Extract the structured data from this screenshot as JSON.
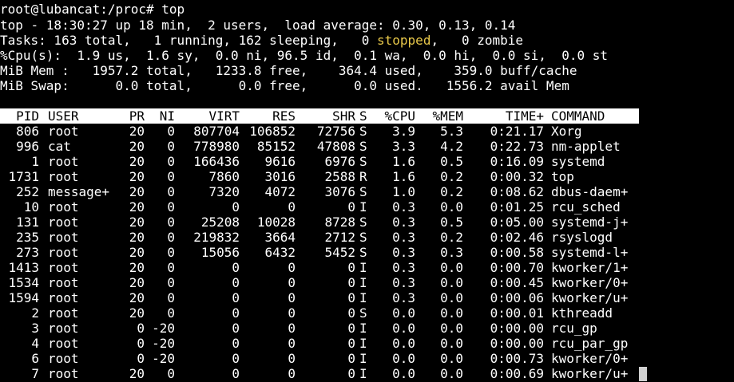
{
  "prompt": "root@lubancat:/proc# top",
  "summary": {
    "uptime_line": "top - 18:30:27 up 18 min,  2 users,  load average: 0.30, 0.13, 0.14",
    "tasks_prefix": "Tasks: 163 total,   1 running, 162 sleeping,   0 ",
    "tasks_stopped_label": "stopped",
    "tasks_suffix": ",   0 zombie",
    "cpu_line": "%Cpu(s):  1.9 us,  1.6 sy,  0.0 ni, 96.5 id,  0.1 wa,  0.0 hi,  0.0 si,  0.0 st",
    "mem_line": "MiB Mem :   1957.2 total,   1233.8 free,    364.4 used,    359.0 buff/cache",
    "swap_line": "MiB Swap:      0.0 total,      0.0 free,      0.0 used.   1556.2 avail Mem"
  },
  "table": {
    "headers": {
      "pid": "PID",
      "user": "USER",
      "pr": "PR",
      "ni": "NI",
      "virt": "VIRT",
      "res": "RES",
      "shr": "SHR",
      "s": "S",
      "cpu": "%CPU",
      "mem": "%MEM",
      "time": "TIME+",
      "command": "COMMAND"
    },
    "rows": [
      {
        "pid": "806",
        "user": "root",
        "pr": "20",
        "ni": "0",
        "virt": "807704",
        "res": "106852",
        "shr": "72756",
        "s": "S",
        "cpu": "3.9",
        "mem": "5.3",
        "time": "0:21.17",
        "command": "Xorg"
      },
      {
        "pid": "996",
        "user": "cat",
        "pr": "20",
        "ni": "0",
        "virt": "778980",
        "res": "85152",
        "shr": "47808",
        "s": "S",
        "cpu": "3.3",
        "mem": "4.2",
        "time": "0:22.73",
        "command": "nm-applet"
      },
      {
        "pid": "1",
        "user": "root",
        "pr": "20",
        "ni": "0",
        "virt": "166436",
        "res": "9616",
        "shr": "6976",
        "s": "S",
        "cpu": "1.6",
        "mem": "0.5",
        "time": "0:16.09",
        "command": "systemd"
      },
      {
        "pid": "1731",
        "user": "root",
        "pr": "20",
        "ni": "0",
        "virt": "7860",
        "res": "3016",
        "shr": "2588",
        "s": "R",
        "cpu": "1.6",
        "mem": "0.2",
        "time": "0:00.32",
        "command": "top"
      },
      {
        "pid": "252",
        "user": "message+",
        "pr": "20",
        "ni": "0",
        "virt": "7320",
        "res": "4072",
        "shr": "3076",
        "s": "S",
        "cpu": "1.0",
        "mem": "0.2",
        "time": "0:08.62",
        "command": "dbus-daem+"
      },
      {
        "pid": "10",
        "user": "root",
        "pr": "20",
        "ni": "0",
        "virt": "0",
        "res": "0",
        "shr": "0",
        "s": "I",
        "cpu": "0.3",
        "mem": "0.0",
        "time": "0:01.25",
        "command": "rcu_sched"
      },
      {
        "pid": "131",
        "user": "root",
        "pr": "20",
        "ni": "0",
        "virt": "25208",
        "res": "10028",
        "shr": "8728",
        "s": "S",
        "cpu": "0.3",
        "mem": "0.5",
        "time": "0:05.00",
        "command": "systemd-j+"
      },
      {
        "pid": "235",
        "user": "root",
        "pr": "20",
        "ni": "0",
        "virt": "219832",
        "res": "3664",
        "shr": "2712",
        "s": "S",
        "cpu": "0.3",
        "mem": "0.2",
        "time": "0:02.46",
        "command": "rsyslogd"
      },
      {
        "pid": "273",
        "user": "root",
        "pr": "20",
        "ni": "0",
        "virt": "15056",
        "res": "6432",
        "shr": "5452",
        "s": "S",
        "cpu": "0.3",
        "mem": "0.3",
        "time": "0:00.58",
        "command": "systemd-l+"
      },
      {
        "pid": "1413",
        "user": "root",
        "pr": "20",
        "ni": "0",
        "virt": "0",
        "res": "0",
        "shr": "0",
        "s": "I",
        "cpu": "0.3",
        "mem": "0.0",
        "time": "0:00.70",
        "command": "kworker/1+"
      },
      {
        "pid": "1534",
        "user": "root",
        "pr": "20",
        "ni": "0",
        "virt": "0",
        "res": "0",
        "shr": "0",
        "s": "I",
        "cpu": "0.3",
        "mem": "0.0",
        "time": "0:00.45",
        "command": "kworker/0+"
      },
      {
        "pid": "1594",
        "user": "root",
        "pr": "20",
        "ni": "0",
        "virt": "0",
        "res": "0",
        "shr": "0",
        "s": "I",
        "cpu": "0.3",
        "mem": "0.0",
        "time": "0:00.06",
        "command": "kworker/u+"
      },
      {
        "pid": "2",
        "user": "root",
        "pr": "20",
        "ni": "0",
        "virt": "0",
        "res": "0",
        "shr": "0",
        "s": "S",
        "cpu": "0.0",
        "mem": "0.0",
        "time": "0:00.01",
        "command": "kthreadd"
      },
      {
        "pid": "3",
        "user": "root",
        "pr": "0",
        "ni": "-20",
        "virt": "0",
        "res": "0",
        "shr": "0",
        "s": "I",
        "cpu": "0.0",
        "mem": "0.0",
        "time": "0:00.00",
        "command": "rcu_gp"
      },
      {
        "pid": "4",
        "user": "root",
        "pr": "0",
        "ni": "-20",
        "virt": "0",
        "res": "0",
        "shr": "0",
        "s": "I",
        "cpu": "0.0",
        "mem": "0.0",
        "time": "0:00.00",
        "command": "rcu_par_gp"
      },
      {
        "pid": "6",
        "user": "root",
        "pr": "0",
        "ni": "-20",
        "virt": "0",
        "res": "0",
        "shr": "0",
        "s": "I",
        "cpu": "0.0",
        "mem": "0.0",
        "time": "0:00.73",
        "command": "kworker/0+"
      },
      {
        "pid": "7",
        "user": "root",
        "pr": "20",
        "ni": "0",
        "virt": "0",
        "res": "0",
        "shr": "0",
        "s": "I",
        "cpu": "0.0",
        "mem": "0.0",
        "time": "0:00.69",
        "command": "kworker/u+"
      }
    ]
  },
  "colors": {
    "background": "#000000",
    "foreground": "#ffffff",
    "header_bar": "#ffffff",
    "stopped_highlight": "#e8c84a",
    "cursor": "#d0d0d0"
  }
}
